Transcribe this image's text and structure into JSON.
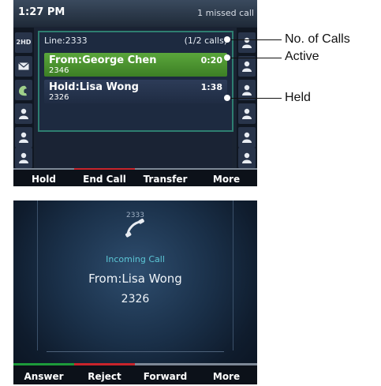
{
  "screen1": {
    "status": {
      "time": "1:27 PM",
      "missed": "1 missed call"
    },
    "line": {
      "label": "Line:2333",
      "count": "(1/2 calls)"
    },
    "calls": [
      {
        "name": "From:George Chen",
        "number": "2346",
        "duration": "0:20",
        "state": "active"
      },
      {
        "name": "Hold:Lisa Wong",
        "number": "2326",
        "duration": "1:38",
        "state": "held"
      }
    ],
    "left_keys": [
      "2HD",
      "envelope",
      "phone-hand",
      "person",
      "person",
      "person"
    ],
    "softkeys": [
      "Hold",
      "End Call",
      "Transfer",
      "More"
    ]
  },
  "annotations": {
    "calls": "No. of Calls",
    "active": "Active",
    "held": "Held"
  },
  "screen2": {
    "line": "2333",
    "title": "Incoming Call",
    "from": "From:Lisa Wong",
    "number": "2326",
    "softkeys": [
      "Answer",
      "Reject",
      "Forward",
      "More"
    ]
  },
  "colors": {
    "active_call": "#4b9a2e",
    "held_call": "#27364f",
    "end_call_accent": "#c8242b",
    "answer_accent": "#1d9a3a",
    "incoming_title": "#5cc7d6"
  }
}
